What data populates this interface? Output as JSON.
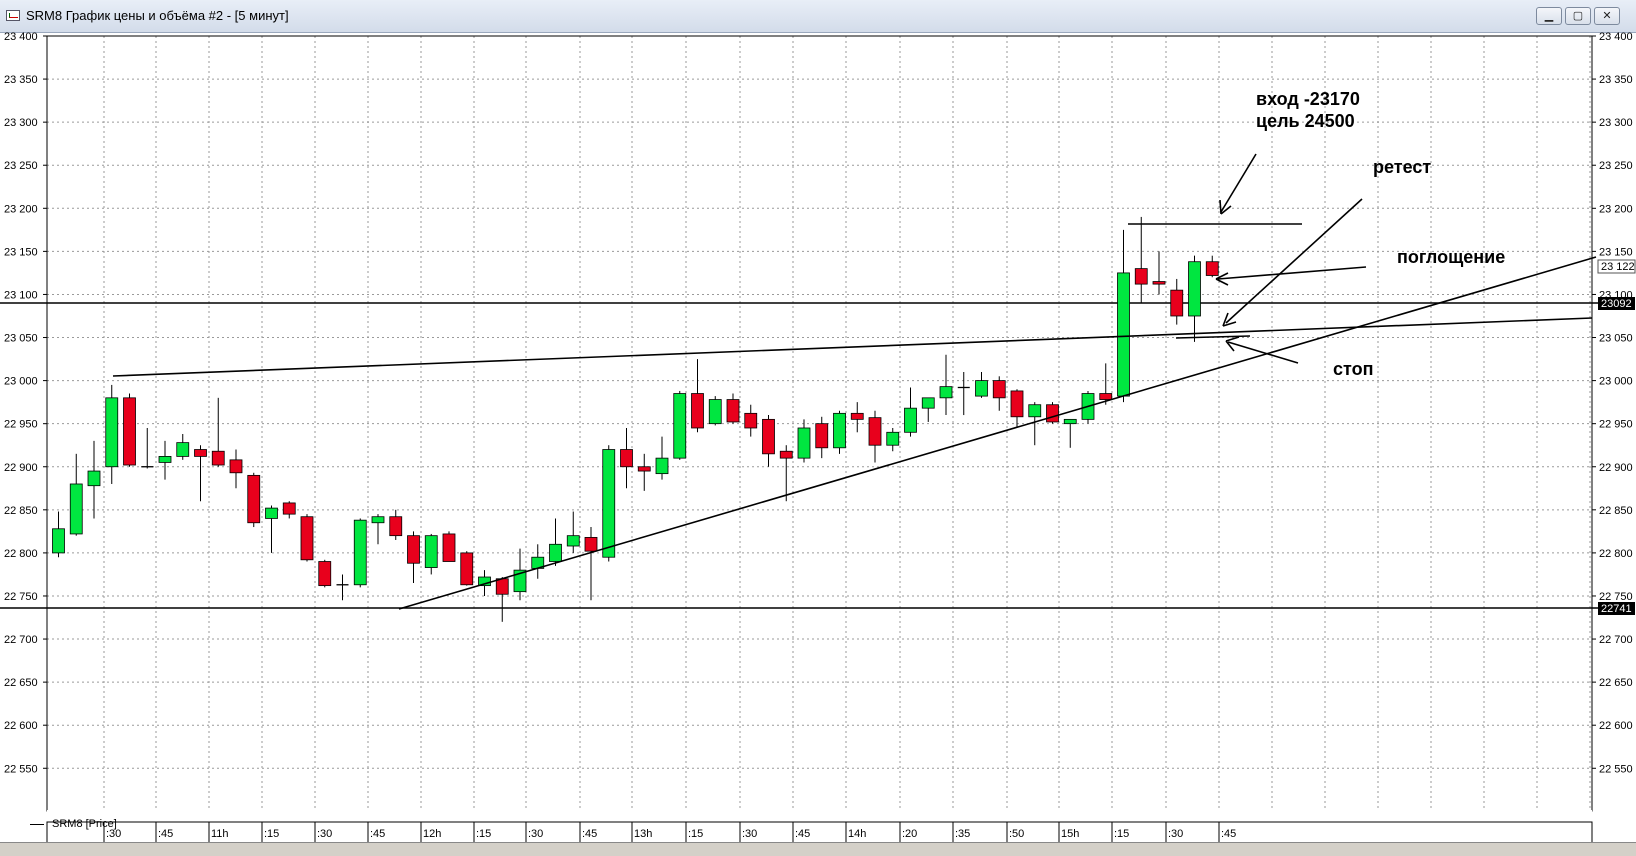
{
  "window": {
    "title": "SRM8 График цены и объёма #2 - [5 минут]",
    "min_glyph": "▁",
    "max_glyph": "▢",
    "close_glyph": "✕"
  },
  "legend": {
    "series_label": "SRM8 [Price]"
  },
  "colors": {
    "bull": "#00e640",
    "bear": "#e8001c",
    "wick": "#000000",
    "line": "#000000",
    "grid": "#9a9a9a"
  },
  "annotations": {
    "entry_line1": "вход -23170",
    "entry_line2": "цель 24500",
    "retest": "ретест",
    "engulfing": "поглощение",
    "stop": "стоп"
  },
  "price_tags": {
    "last": "23 122",
    "level_high": "23092",
    "level_low": "22741"
  },
  "chart_data": {
    "type": "candlestick",
    "title": "",
    "y_ticks": [
      "23 400",
      "23 350",
      "23 300",
      "23 250",
      "23 200",
      "23 150",
      "23 100",
      "23 050",
      "23 000",
      "22 950",
      "22 900",
      "22 850",
      "22 800",
      "22 750",
      "22 700",
      "22 650",
      "22 600",
      "22 550"
    ],
    "ylim": [
      22500,
      23400
    ],
    "x_labels": [
      ":30",
      ":45",
      "11h",
      ":15",
      ":30",
      ":45",
      "12h",
      ":15",
      ":30",
      ":45",
      "13h",
      ":15",
      ":30",
      ":45",
      "14h",
      ":20",
      ":35",
      ":50",
      "15h",
      ":15",
      ":30",
      ":45"
    ],
    "grid": true,
    "candles": [
      {
        "o": 22800,
        "h": 22848,
        "l": 22795,
        "c": 22828
      },
      {
        "o": 22822,
        "h": 22915,
        "l": 22820,
        "c": 22880
      },
      {
        "o": 22878,
        "h": 22930,
        "l": 22840,
        "c": 22895
      },
      {
        "o": 22900,
        "h": 22995,
        "l": 22880,
        "c": 22980
      },
      {
        "o": 22980,
        "h": 22985,
        "l": 22900,
        "c": 22902
      },
      {
        "o": 22900,
        "h": 22945,
        "l": 22898,
        "c": 22900
      },
      {
        "o": 22905,
        "h": 22930,
        "l": 22885,
        "c": 22912
      },
      {
        "o": 22912,
        "h": 22938,
        "l": 22908,
        "c": 22928
      },
      {
        "o": 22920,
        "h": 22925,
        "l": 22860,
        "c": 22912
      },
      {
        "o": 22918,
        "h": 22980,
        "l": 22900,
        "c": 22902
      },
      {
        "o": 22908,
        "h": 22920,
        "l": 22875,
        "c": 22893
      },
      {
        "o": 22890,
        "h": 22893,
        "l": 22830,
        "c": 22835
      },
      {
        "o": 22840,
        "h": 22855,
        "l": 22800,
        "c": 22852
      },
      {
        "o": 22858,
        "h": 22860,
        "l": 22840,
        "c": 22845
      },
      {
        "o": 22842,
        "h": 22845,
        "l": 22790,
        "c": 22792
      },
      {
        "o": 22790,
        "h": 22792,
        "l": 22760,
        "c": 22762
      },
      {
        "o": 22762,
        "h": 22775,
        "l": 22745,
        "c": 22763
      },
      {
        "o": 22763,
        "h": 22840,
        "l": 22760,
        "c": 22838
      },
      {
        "o": 22835,
        "h": 22845,
        "l": 22810,
        "c": 22842
      },
      {
        "o": 22842,
        "h": 22850,
        "l": 22815,
        "c": 22820
      },
      {
        "o": 22820,
        "h": 22825,
        "l": 22765,
        "c": 22788
      },
      {
        "o": 22783,
        "h": 22822,
        "l": 22775,
        "c": 22820
      },
      {
        "o": 22822,
        "h": 22825,
        "l": 22790,
        "c": 22790
      },
      {
        "o": 22800,
        "h": 22802,
        "l": 22762,
        "c": 22763
      },
      {
        "o": 22762,
        "h": 22780,
        "l": 22750,
        "c": 22772
      },
      {
        "o": 22770,
        "h": 22772,
        "l": 22720,
        "c": 22752
      },
      {
        "o": 22755,
        "h": 22805,
        "l": 22745,
        "c": 22780
      },
      {
        "o": 22782,
        "h": 22810,
        "l": 22770,
        "c": 22795
      },
      {
        "o": 22790,
        "h": 22840,
        "l": 22785,
        "c": 22810
      },
      {
        "o": 22808,
        "h": 22848,
        "l": 22800,
        "c": 22820
      },
      {
        "o": 22818,
        "h": 22830,
        "l": 22745,
        "c": 22802
      },
      {
        "o": 22795,
        "h": 22925,
        "l": 22790,
        "c": 22920
      },
      {
        "o": 22920,
        "h": 22945,
        "l": 22875,
        "c": 22900
      },
      {
        "o": 22900,
        "h": 22915,
        "l": 22872,
        "c": 22895
      },
      {
        "o": 22892,
        "h": 22935,
        "l": 22885,
        "c": 22910
      },
      {
        "o": 22910,
        "h": 22988,
        "l": 22908,
        "c": 22985
      },
      {
        "o": 22985,
        "h": 23025,
        "l": 22940,
        "c": 22945
      },
      {
        "o": 22950,
        "h": 22982,
        "l": 22948,
        "c": 22978
      },
      {
        "o": 22978,
        "h": 22985,
        "l": 22950,
        "c": 22952
      },
      {
        "o": 22962,
        "h": 22972,
        "l": 22935,
        "c": 22945
      },
      {
        "o": 22955,
        "h": 22960,
        "l": 22900,
        "c": 22915
      },
      {
        "o": 22918,
        "h": 22925,
        "l": 22860,
        "c": 22910
      },
      {
        "o": 22910,
        "h": 22955,
        "l": 22905,
        "c": 22945
      },
      {
        "o": 22950,
        "h": 22958,
        "l": 22910,
        "c": 22922
      },
      {
        "o": 22922,
        "h": 22965,
        "l": 22915,
        "c": 22962
      },
      {
        "o": 22962,
        "h": 22975,
        "l": 22940,
        "c": 22955
      },
      {
        "o": 22957,
        "h": 22965,
        "l": 22905,
        "c": 22925
      },
      {
        "o": 22925,
        "h": 22945,
        "l": 22918,
        "c": 22940
      },
      {
        "o": 22940,
        "h": 22992,
        "l": 22935,
        "c": 22968
      },
      {
        "o": 22968,
        "h": 22978,
        "l": 22952,
        "c": 22980
      },
      {
        "o": 22980,
        "h": 23030,
        "l": 22960,
        "c": 22993
      },
      {
        "o": 22992,
        "h": 23010,
        "l": 22960,
        "c": 22992
      },
      {
        "o": 22982,
        "h": 23010,
        "l": 22980,
        "c": 23000
      },
      {
        "o": 23000,
        "h": 23005,
        "l": 22965,
        "c": 22980
      },
      {
        "o": 22988,
        "h": 22990,
        "l": 22945,
        "c": 22958
      },
      {
        "o": 22958,
        "h": 22975,
        "l": 22925,
        "c": 22972
      },
      {
        "o": 22972,
        "h": 22975,
        "l": 22950,
        "c": 22952
      },
      {
        "o": 22950,
        "h": 22955,
        "l": 22922,
        "c": 22955
      },
      {
        "o": 22955,
        "h": 22988,
        "l": 22950,
        "c": 22985
      },
      {
        "o": 22985,
        "h": 23020,
        "l": 22972,
        "c": 22978
      },
      {
        "o": 22982,
        "h": 23175,
        "l": 22975,
        "c": 23125
      },
      {
        "o": 23130,
        "h": 23190,
        "l": 23090,
        "c": 23112
      },
      {
        "o": 23115,
        "h": 23150,
        "l": 23100,
        "c": 23112
      },
      {
        "o": 23105,
        "h": 23118,
        "l": 23065,
        "c": 23075
      },
      {
        "o": 23075,
        "h": 23145,
        "l": 23045,
        "c": 23138
      },
      {
        "o": 23138,
        "h": 23145,
        "l": 23120,
        "c": 23122
      }
    ]
  }
}
